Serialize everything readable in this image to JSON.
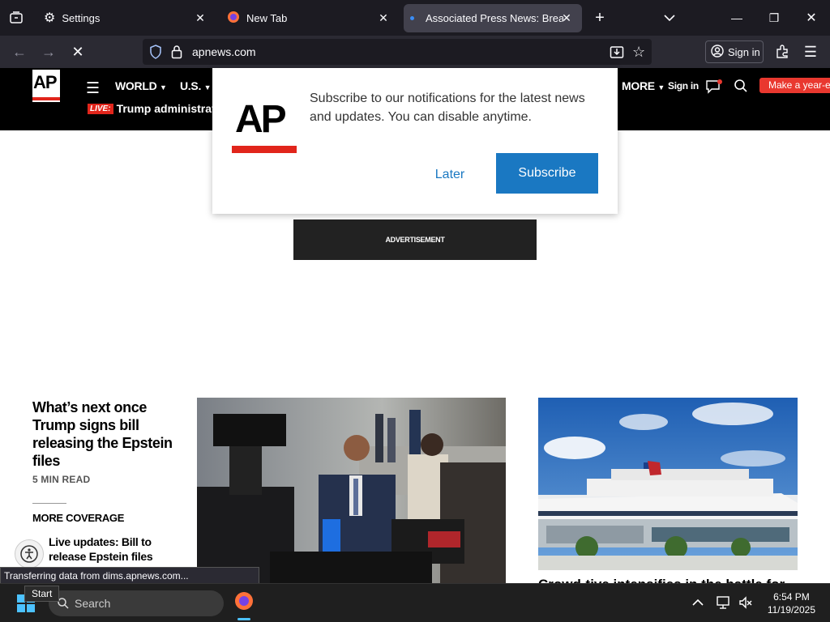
{
  "browser": {
    "tabs": [
      {
        "title": "Settings",
        "icon": "gear-icon"
      },
      {
        "title": "New Tab",
        "icon": "firefox-icon"
      },
      {
        "title": "Associated Press News: Breaking",
        "icon": "loading-dot-icon",
        "active": true
      }
    ],
    "url": "apnews.com",
    "sign_in": "Sign in"
  },
  "ap_header": {
    "nav": [
      "WORLD",
      "U.S.",
      "MORE"
    ],
    "sign_in": "Sign in",
    "live_badge": "LIVE:",
    "live_headline": "Trump administration",
    "cta": "Make a year-e"
  },
  "popup": {
    "logo_text": "AP",
    "message": "Subscribe to our notifications for the latest news and updates. You can disable anytime.",
    "later": "Later",
    "subscribe": "Subscribe",
    "accent": "#1a78c2",
    "logo_red": "#e1251b"
  },
  "ad": {
    "label": "ADVERTISEMENT"
  },
  "articles": {
    "main_headline": "What’s next once Trump signs bill releasing the Epstein files",
    "read_time": "5 MIN READ",
    "more_coverage": "MORE COVERAGE",
    "related": "Live updates: Bill to release Epstein files heads to",
    "second_caption": "Crowd-tive intensifies in the battle for"
  },
  "status_bar": "Transferring data from dims.apnews.com...",
  "taskbar": {
    "start_tip": "Start",
    "search": "Search",
    "time": "6:54 PM",
    "date": "11/19/2025"
  }
}
